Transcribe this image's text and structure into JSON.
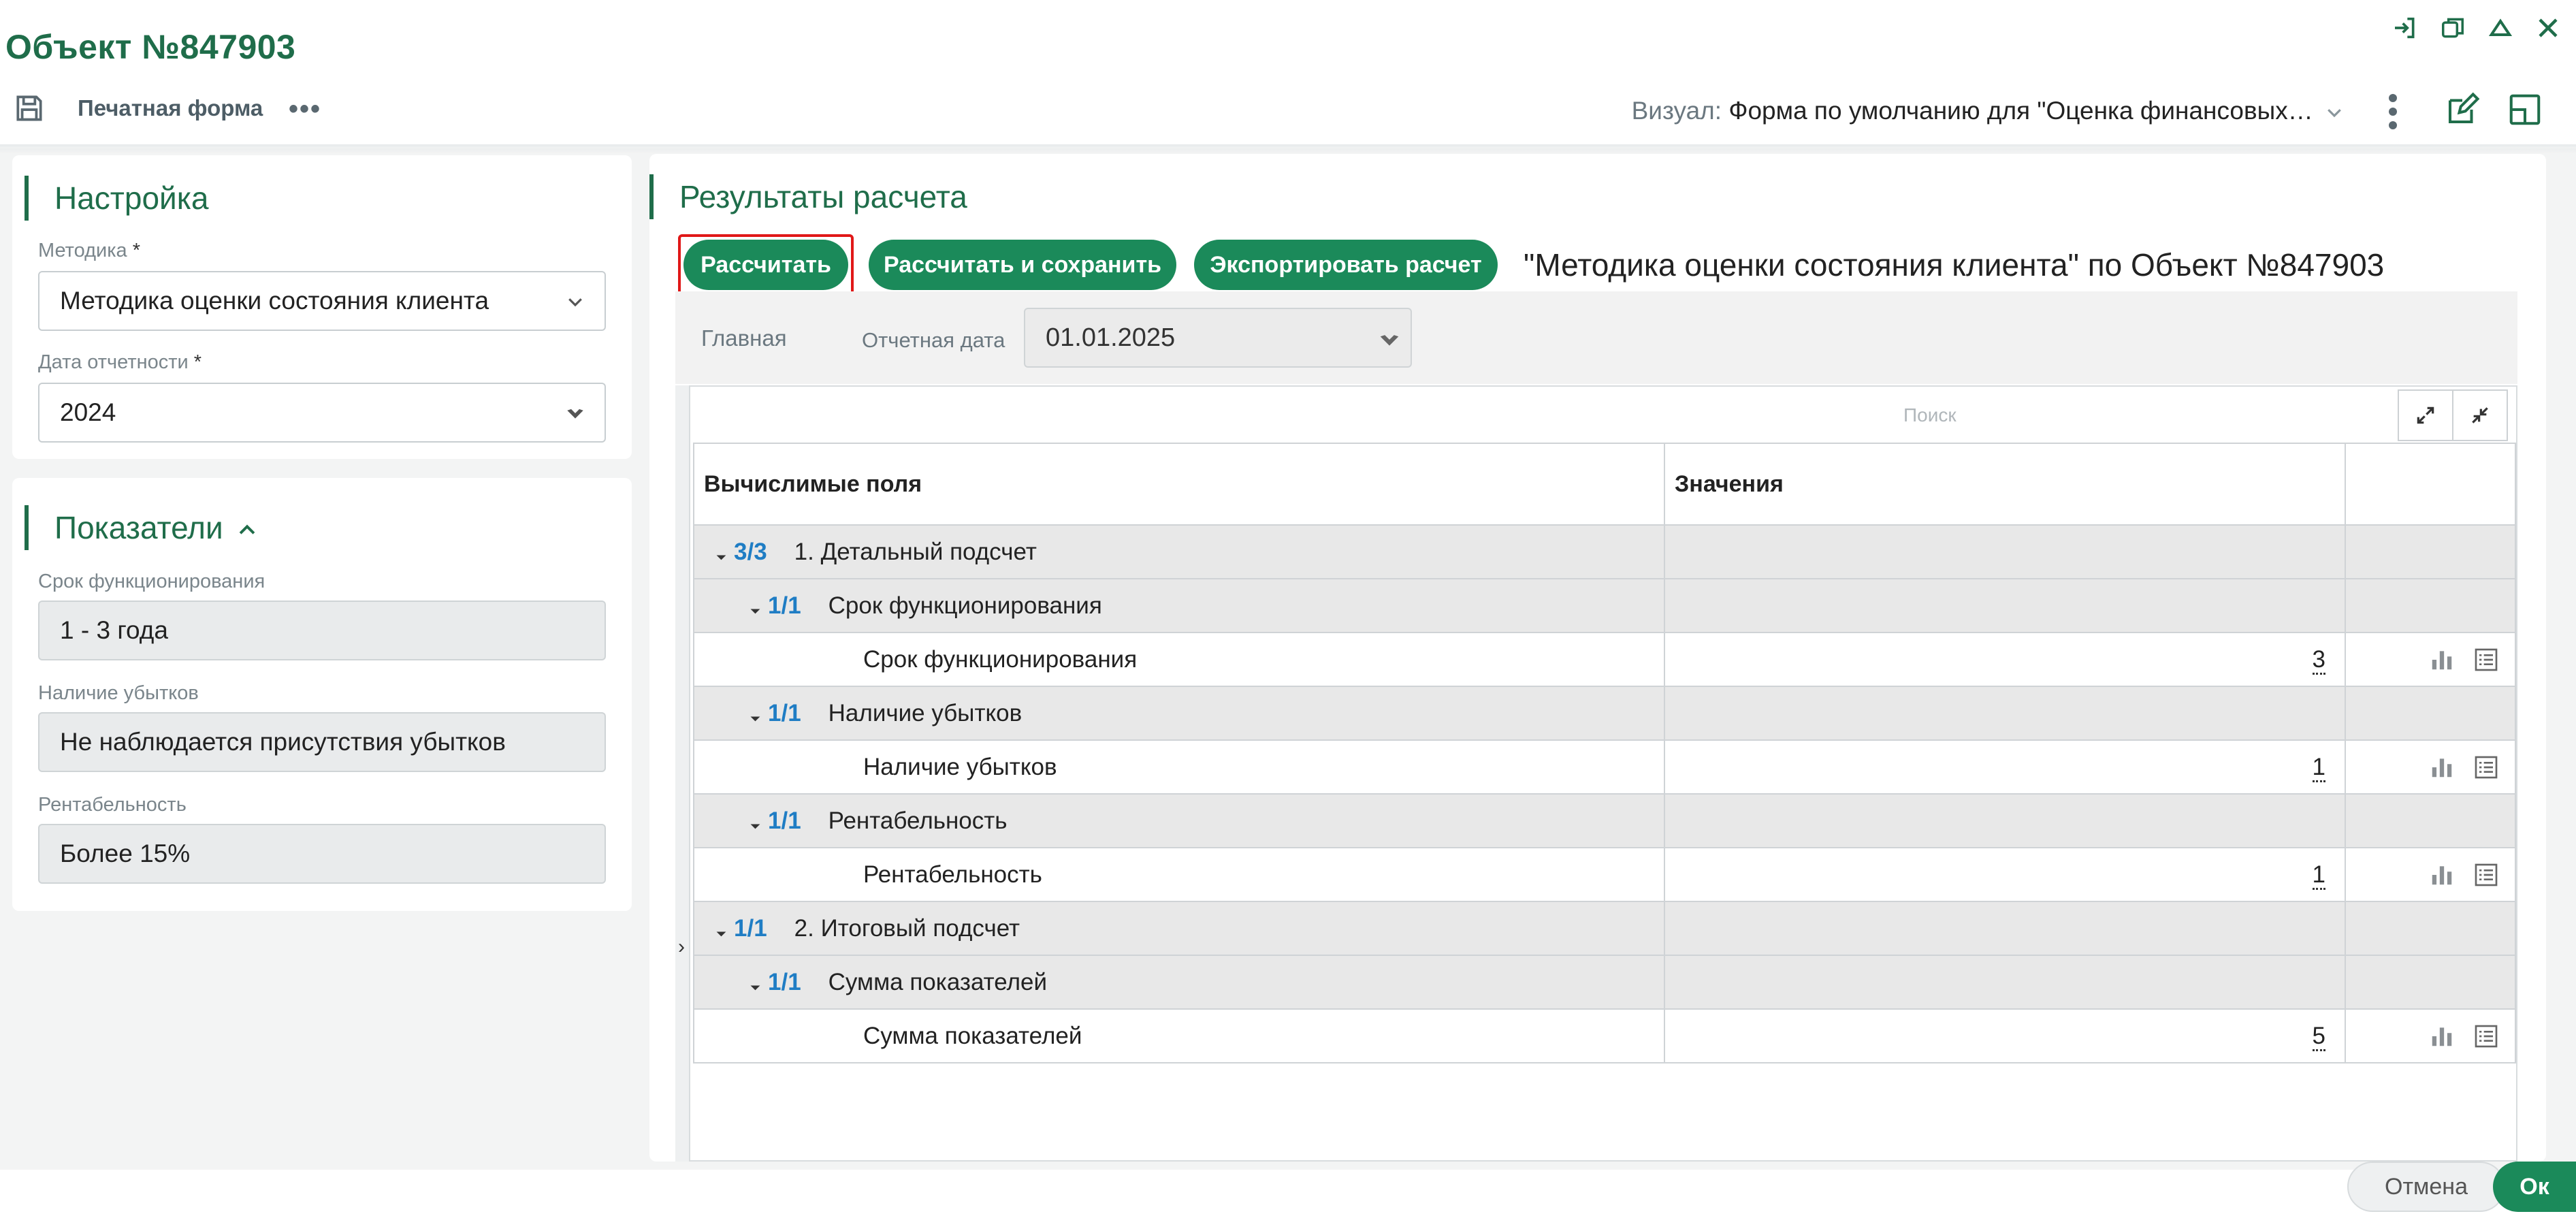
{
  "window": {
    "title": "Объект №847903"
  },
  "toolbar": {
    "print_form": "Печатная форма",
    "more": "•••"
  },
  "visual": {
    "label": "Визуал:",
    "value": "Форма по умолчанию для \"Оценка финансовых…"
  },
  "settings": {
    "title": "Настройка",
    "method_label": "Методика",
    "method_value": "Методика оценки состояния клиента",
    "date_label": "Дата отчетности",
    "date_value": "2024",
    "required_mark": "*"
  },
  "indicators": {
    "title": "Показатели",
    "fields": [
      {
        "label": "Срок функционирования",
        "value": "1 - 3 года"
      },
      {
        "label": "Наличие убытков",
        "value": "Не наблюдается присутствия убытков"
      },
      {
        "label": "Рентабельность",
        "value": "Более 15%"
      }
    ]
  },
  "results": {
    "title": "Результаты расчета",
    "buttons": {
      "calculate": "Рассчитать",
      "calculate_save": "Рассчитать и сохранить",
      "export": "Экспортировать расчет"
    },
    "heading": "\"Методика оценки состояния клиента\" по Объект №847903",
    "filter": {
      "tab": "Главная",
      "date_label": "Отчетная дата",
      "date_value": "01.01.2025"
    },
    "search_placeholder": "Поиск",
    "columns": [
      "Вычислимые поля",
      "Значения"
    ],
    "rows": [
      {
        "level": 0,
        "type": "group",
        "count": "3/3",
        "label": "1. Детальный подсчет"
      },
      {
        "level": 1,
        "type": "group",
        "count": "1/1",
        "label": "Срок функционирования"
      },
      {
        "level": 2,
        "type": "leaf",
        "label": "Срок функционирования",
        "value": "3"
      },
      {
        "level": 1,
        "type": "group",
        "count": "1/1",
        "label": "Наличие убытков"
      },
      {
        "level": 2,
        "type": "leaf",
        "label": "Наличие убытков",
        "value": "1"
      },
      {
        "level": 1,
        "type": "group",
        "count": "1/1",
        "label": "Рентабельность"
      },
      {
        "level": 2,
        "type": "leaf",
        "label": "Рентабельность",
        "value": "1"
      },
      {
        "level": 0,
        "type": "group",
        "count": "1/1",
        "label": "2. Итоговый подсчет"
      },
      {
        "level": 1,
        "type": "group",
        "count": "1/1",
        "label": "Сумма показателей"
      },
      {
        "level": 2,
        "type": "leaf",
        "label": "Сумма показателей",
        "value": "5"
      }
    ]
  },
  "footer": {
    "cancel": "Отмена",
    "ok": "Ок"
  },
  "colors": {
    "brand": "#1f6d4a",
    "button": "#1b8a5a",
    "link": "#1f7dc4",
    "highlight": "#e01818"
  }
}
